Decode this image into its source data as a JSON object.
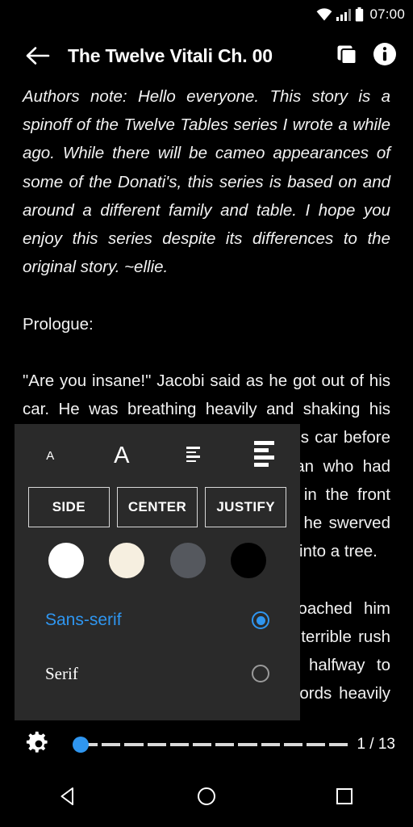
{
  "status_bar": {
    "clock": "07:00",
    "icons": [
      "wifi-icon",
      "cellular-signal-icon",
      "battery-icon"
    ]
  },
  "app_bar": {
    "back_icon": "arrow-back-icon",
    "title": "The Twelve Vitali Ch. 00",
    "actions": [
      {
        "icon": "copy-pages-icon"
      },
      {
        "icon": "info-icon"
      }
    ]
  },
  "reader": {
    "paragraphs": [
      {
        "style": "note",
        "text": "Authors note: Hello everyone. This story is a spinoff of the Twelve Tables series I wrote a while ago. While there will be cameo appearances of some of the Donati's, this series is based on and around a different family and table. I hope you enjoy this series despite its differences to the original story. ~ellie."
      },
      {
        "style": "spacer",
        "text": ""
      },
      {
        "style": "body",
        "text": "Prologue:"
      },
      {
        "style": "spacer",
        "text": ""
      },
      {
        "style": "body",
        "text": "\"Are you insane!\" Jacobi said as he got out of his car. He was breathing heavily and shaking his head, looking at the tree in front of his car before turning his irate glare on the woman who had pulled him over. There was a dent in the front bumper that had been caused when he swerved to help, which sent his brand new car into a tree."
      },
      {
        "style": "spacer",
        "text": ""
      },
      {
        "style": "body",
        "text": "\"I am so sorry,\" the woman approached him quickly. \"I feel terrible and I am in a terrible rush because I have run out of petrol halfway to Palermo.\" She said in a rush, her words heavily breathed as"
      }
    ]
  },
  "settings_panel": {
    "size_controls": [
      {
        "name": "decrease-font-size",
        "icon": "small-a-icon",
        "label": "A"
      },
      {
        "name": "increase-font-size",
        "icon": "large-a-icon",
        "label": "A"
      },
      {
        "name": "decrease-line-spacing",
        "icon": "line-spacing-small-icon",
        "label": ""
      },
      {
        "name": "increase-line-spacing",
        "icon": "line-spacing-large-icon",
        "label": ""
      }
    ],
    "alignment_buttons": [
      {
        "label": "SIDE"
      },
      {
        "label": "CENTER"
      },
      {
        "label": "JUSTIFY"
      }
    ],
    "color_swatches": [
      {
        "name": "theme-white",
        "color": "#ffffff"
      },
      {
        "name": "theme-sepia",
        "color": "#f6efe0"
      },
      {
        "name": "theme-gray",
        "color": "#55585e"
      },
      {
        "name": "theme-black",
        "color": "#000000"
      }
    ],
    "font_options": [
      {
        "label": "Sans-serif",
        "selected": true,
        "color": "#2f96f0"
      },
      {
        "label": "Serif",
        "selected": false,
        "color": "#ffffff"
      }
    ]
  },
  "bottom_bar": {
    "gear_icon": "gear-icon",
    "seek": {
      "segments": 12,
      "value": 1,
      "thumb_color": "#2f96f0",
      "track_color": "#d9d9d9"
    },
    "page_indicator": "1 / 13"
  },
  "nav_bar": {
    "buttons": [
      {
        "name": "nav-back-button",
        "icon": "triangle-back-icon"
      },
      {
        "name": "nav-home-button",
        "icon": "circle-home-icon"
      },
      {
        "name": "nav-recents-button",
        "icon": "square-recents-icon"
      }
    ]
  }
}
